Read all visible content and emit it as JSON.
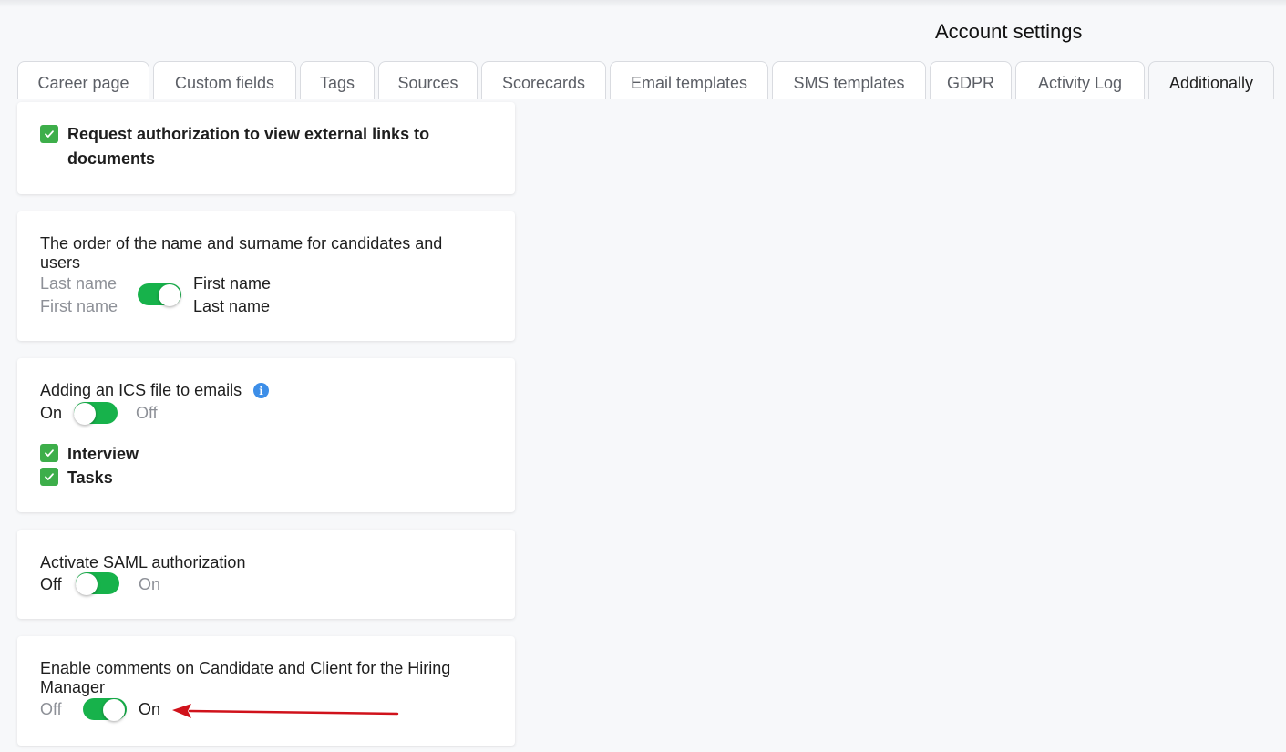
{
  "header": {
    "title": "Account settings"
  },
  "tabs": [
    {
      "label": "Career page"
    },
    {
      "label": "Custom fields"
    },
    {
      "label": "Tags"
    },
    {
      "label": "Sources"
    },
    {
      "label": "Scorecards"
    },
    {
      "label": "Email templates"
    },
    {
      "label": "SMS templates"
    },
    {
      "label": "GDPR"
    },
    {
      "label": "Activity Log"
    },
    {
      "label": "Additionally",
      "active": true
    }
  ],
  "cards": {
    "external_links": {
      "checkbox_label_line1": "Request authorization to view external links to",
      "checkbox_label_line2": "documents",
      "checked": true
    },
    "name_order": {
      "title_line1": "The order of the name and surname for candidates and",
      "title_line2": "users",
      "left_line1": "Last name",
      "left_line2": "First name",
      "right_line1": "First name",
      "right_line2": "Last name",
      "toggle_on": true
    },
    "ics": {
      "title": "Adding an ICS file to emails",
      "left_label": "On",
      "right_label": "Off",
      "toggle_on": false,
      "options": [
        {
          "label": "Interview",
          "checked": true
        },
        {
          "label": "Tasks",
          "checked": true
        }
      ]
    },
    "saml": {
      "title": "Activate SAML authorization",
      "left_label": "Off",
      "right_label": "On",
      "toggle_on": false
    },
    "comments": {
      "title_line1": "Enable comments on Candidate and Client for the Hiring",
      "title_line2": "Manager",
      "left_label": "Off",
      "right_label": "On",
      "toggle_on": true
    }
  },
  "colors": {
    "accent_green": "#17b24b",
    "checkbox_green": "#3dae4a",
    "info_blue": "#3c8ee8",
    "annotation_red": "#d0121b"
  },
  "icons": {
    "check": "check-icon",
    "info": "info-icon",
    "annotation": "red-arrow-annotation"
  }
}
